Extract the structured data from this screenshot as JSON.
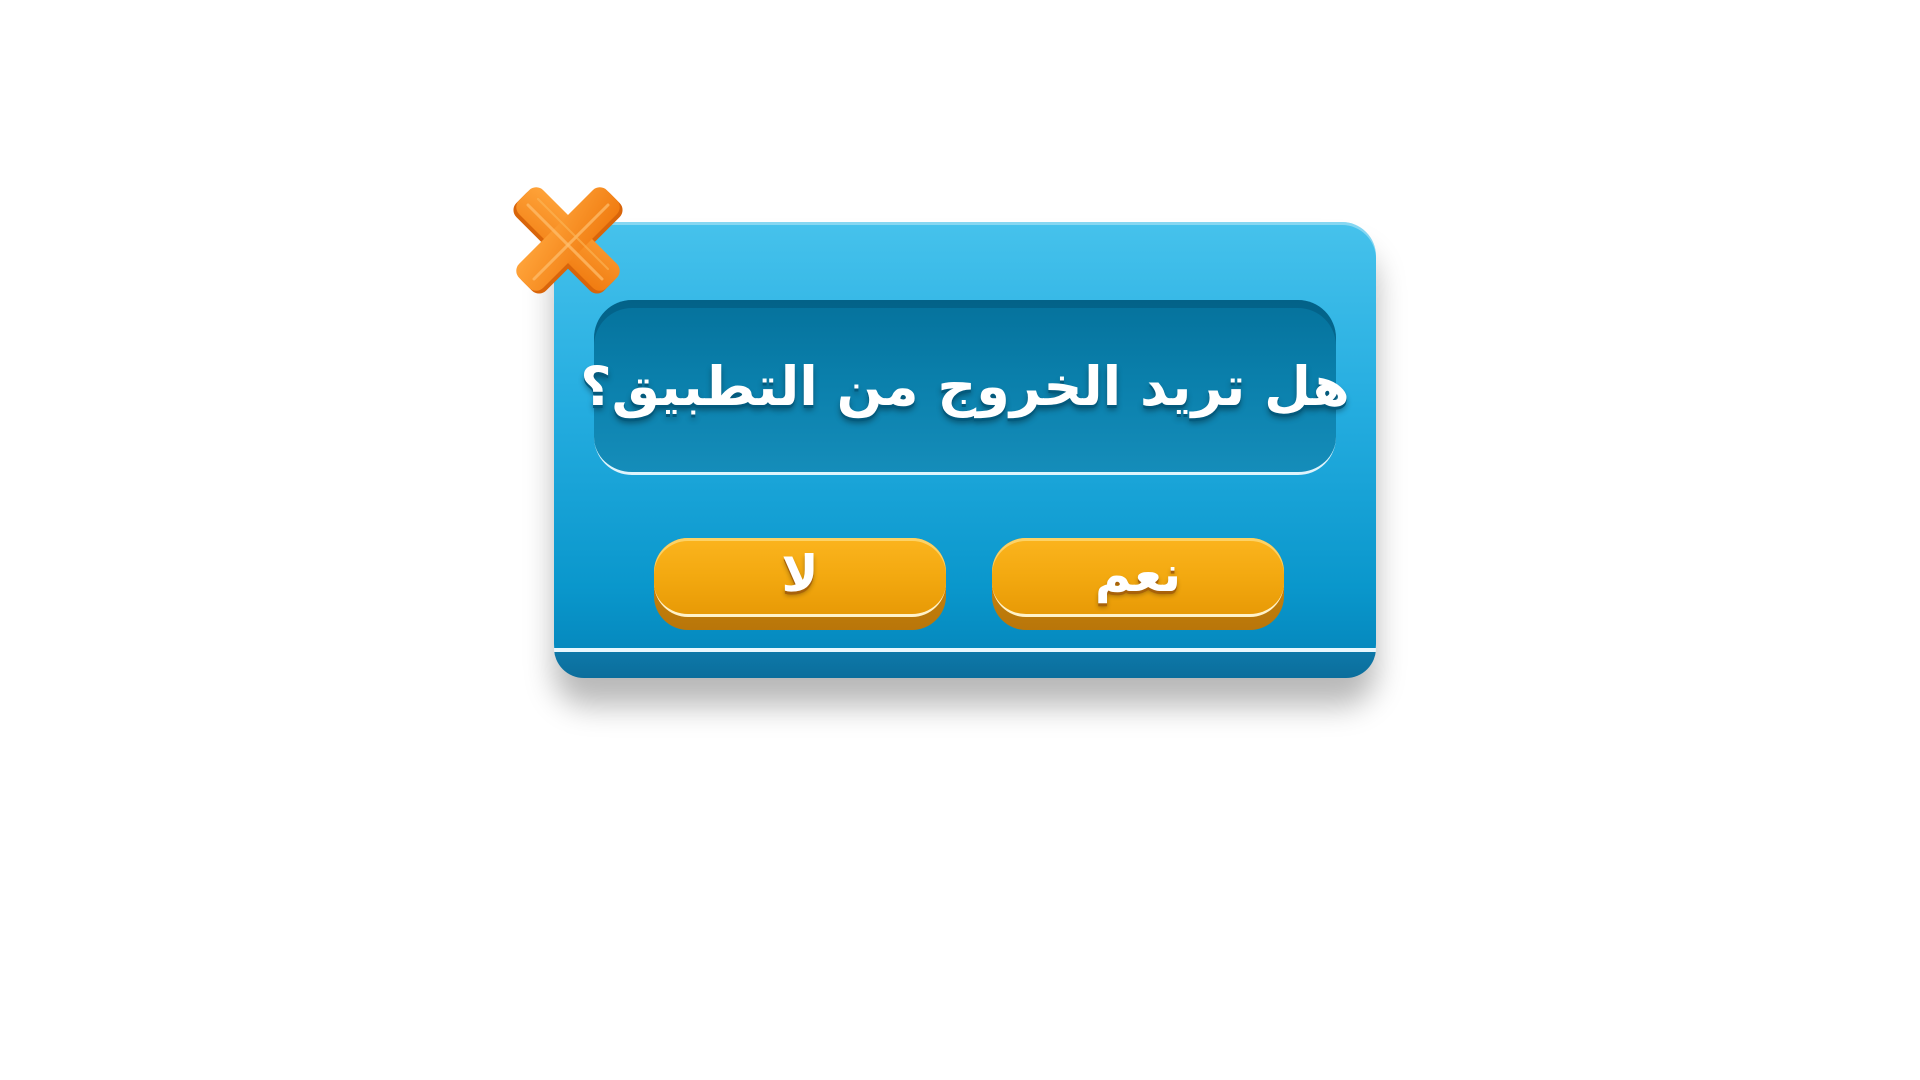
{
  "dialog": {
    "message": "هل تريد الخروج من التطبيق؟",
    "buttons": {
      "yes_label": "نعم",
      "no_label": "لا"
    },
    "close_icon": "close-x-icon"
  },
  "colors": {
    "panel": "#25ade0",
    "message_box": "#0a7fab",
    "button": "#f3a910",
    "close": "#f7931e"
  }
}
